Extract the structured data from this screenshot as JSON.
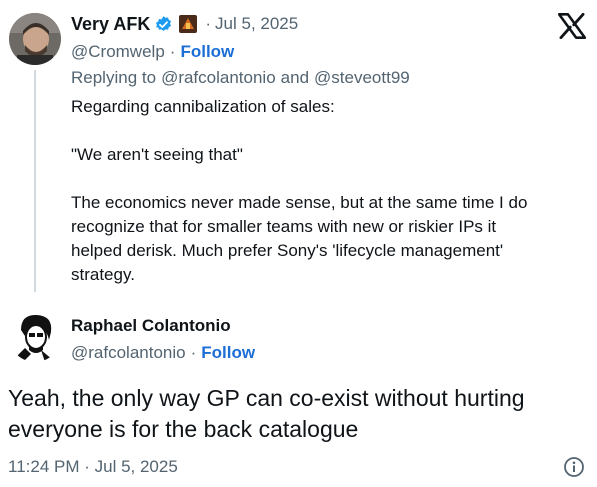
{
  "reply_tweet": {
    "display_name": "Very AFK",
    "handle": "@Cromwelp",
    "date": "Jul 5, 2025",
    "separator": "·",
    "follow_label": "Follow",
    "replying_prefix": "Replying to",
    "replying_user1": "@rafcolantonio",
    "replying_and": "and",
    "replying_user2": "@steveott99",
    "lines": [
      "Regarding cannibalization of sales:",
      "",
      "\"We aren't seeing that\"",
      "",
      "The economics never made sense, but at the same time I do",
      "recognize that for smaller teams with new or riskier IPs it",
      "helped derisk. Much prefer Sony's 'lifecycle management'",
      "strategy."
    ]
  },
  "main_tweet": {
    "display_name": "Raphael Colantonio",
    "handle": "@rafcolantonio",
    "separator": "·",
    "follow_label": "Follow",
    "text_line1": "Yeah, the only way GP can co-exist without hurting",
    "text_line2": "everyone is for the back catalogue",
    "timestamp": "11:24 PM · Jul 5, 2025"
  },
  "icons": {
    "brand": "x-logo-icon",
    "verified": "verified-badge-icon",
    "flair": "game-flair-icon",
    "info": "info-icon"
  },
  "colors": {
    "follow": "#1d6fd6",
    "verified": "#1d9bf0",
    "muted": "#536471",
    "text": "#0f1419"
  }
}
